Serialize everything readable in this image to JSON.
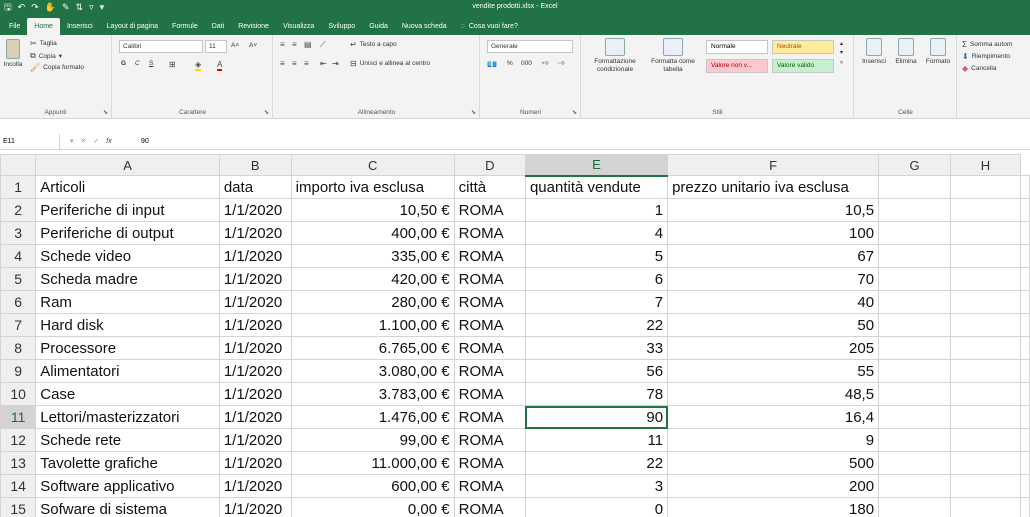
{
  "window": {
    "title": "vendite prodotti.xlsx  -  Excel",
    "quick_access": [
      "save-icon",
      "undo-icon",
      "redo-icon",
      "touch-mode-icon",
      "format-painter-icon",
      "sort-icon",
      "filter-icon",
      "customize-icon"
    ]
  },
  "tabs": [
    "File",
    "Home",
    "Inserisci",
    "Layout di pagina",
    "Formule",
    "Dati",
    "Revisione",
    "Visualizza",
    "Sviluppo",
    "Guida",
    "Nuova scheda"
  ],
  "active_tab": "Home",
  "tell_me": "Cosa vuoi fare?",
  "ribbon": {
    "clipboard": {
      "paste": "Incolla",
      "cut": "Taglia",
      "copy": "Copia",
      "copy_arrow": "▾",
      "format_painter": "Copia formato",
      "label": "Appunti"
    },
    "font": {
      "name": "Calibri",
      "size": "11",
      "grow": "A˄",
      "shrink": "A˅",
      "bold": "G",
      "italic": "C",
      "underline": "S",
      "label": "Carattere"
    },
    "alignment": {
      "wrap": "Testo a capo",
      "merge": "Unisci e allinea al centro",
      "label": "Allineamento"
    },
    "number": {
      "format": "Generale",
      "percent": "%",
      "thousands": "000",
      "label": "Numeri"
    },
    "styles": {
      "conditional": "Formattazione condizionale",
      "table": "Formatta come tabella",
      "cells": [
        {
          "text": "Normale",
          "bg": "#ffffff",
          "color": "#000000"
        },
        {
          "text": "Neutrale",
          "bg": "#ffeb9c",
          "color": "#9c5700"
        },
        {
          "text": "Valore non v...",
          "bg": "#ffc7ce",
          "color": "#9c0006"
        },
        {
          "text": "Valore valido",
          "bg": "#c6efce",
          "color": "#006100"
        }
      ],
      "label": "Stili"
    },
    "cells": {
      "insert": "Inserisci",
      "delete": "Elimina",
      "format": "Formato",
      "label": "Celle"
    },
    "editing": {
      "autosum": "Somma autom",
      "fill": "Riempimento",
      "clear": "Cancella"
    }
  },
  "formula_bar": {
    "name_box": "E11",
    "value": "90",
    "cancel": "✕",
    "enter": "✓",
    "fx": "fx"
  },
  "columns": [
    "A",
    "B",
    "C",
    "D",
    "E",
    "F",
    "G",
    "H"
  ],
  "selected_column": "E",
  "selected_row": 11,
  "rows": [
    {
      "n": 1,
      "cells": [
        "Articoli",
        "data",
        "importo iva esclusa",
        "città",
        "quantità vendute",
        "prezzo unitario iva esclusa",
        "",
        ""
      ]
    },
    {
      "n": 2,
      "cells": [
        "Periferiche di input",
        "1/1/2020",
        "10,50 €",
        "ROMA",
        "1",
        "10,5",
        "",
        ""
      ]
    },
    {
      "n": 3,
      "cells": [
        "Periferiche di output",
        "1/1/2020",
        "400,00 €",
        "ROMA",
        "4",
        "100",
        "",
        ""
      ]
    },
    {
      "n": 4,
      "cells": [
        "Schede video",
        "1/1/2020",
        "335,00 €",
        "ROMA",
        "5",
        "67",
        "",
        ""
      ]
    },
    {
      "n": 5,
      "cells": [
        "Scheda madre",
        "1/1/2020",
        "420,00 €",
        "ROMA",
        "6",
        "70",
        "",
        ""
      ]
    },
    {
      "n": 6,
      "cells": [
        "Ram",
        "1/1/2020",
        "280,00 €",
        "ROMA",
        "7",
        "40",
        "",
        ""
      ]
    },
    {
      "n": 7,
      "cells": [
        "Hard disk",
        "1/1/2020",
        "1.100,00 €",
        "ROMA",
        "22",
        "50",
        "",
        ""
      ]
    },
    {
      "n": 8,
      "cells": [
        "Processore",
        "1/1/2020",
        "6.765,00 €",
        "ROMA",
        "33",
        "205",
        "",
        ""
      ]
    },
    {
      "n": 9,
      "cells": [
        "Alimentatori",
        "1/1/2020",
        "3.080,00 €",
        "ROMA",
        "56",
        "55",
        "",
        ""
      ]
    },
    {
      "n": 10,
      "cells": [
        "Case",
        "1/1/2020",
        "3.783,00 €",
        "ROMA",
        "78",
        "48,5",
        "",
        ""
      ]
    },
    {
      "n": 11,
      "cells": [
        "Lettori/masterizzatori",
        "1/1/2020",
        "1.476,00 €",
        "ROMA",
        "90",
        "16,4",
        "",
        ""
      ]
    },
    {
      "n": 12,
      "cells": [
        "Schede rete",
        "1/1/2020",
        "99,00 €",
        "ROMA",
        "11",
        "9",
        "",
        ""
      ]
    },
    {
      "n": 13,
      "cells": [
        "Tavolette grafiche",
        "1/1/2020",
        "11.000,00 €",
        "ROMA",
        "22",
        "500",
        "",
        ""
      ]
    },
    {
      "n": 14,
      "cells": [
        "Software applicativo",
        "1/1/2020",
        "600,00 €",
        "ROMA",
        "3",
        "200",
        "",
        ""
      ]
    },
    {
      "n": 15,
      "cells": [
        "Sofware di sistema",
        "1/1/2020",
        "0,00 €",
        "ROMA",
        "0",
        "180",
        "",
        ""
      ]
    }
  ]
}
